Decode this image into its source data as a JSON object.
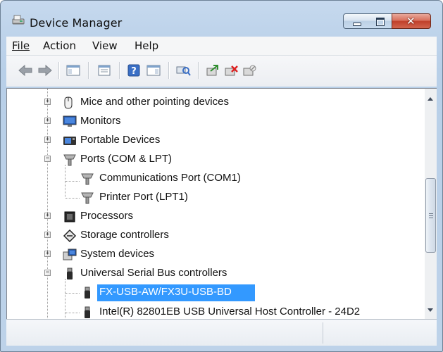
{
  "window": {
    "title": "Device Manager",
    "icon": "device-manager-icon"
  },
  "title_buttons": {
    "minimize_icon": "minimize-icon",
    "maximize_icon": "maximize-icon",
    "close_icon": "close-icon",
    "close_glyph": "✕"
  },
  "menu": [
    {
      "key": "file",
      "label": "File"
    },
    {
      "key": "action",
      "label": "Action"
    },
    {
      "key": "view",
      "label": "View"
    },
    {
      "key": "help",
      "label": "Help"
    }
  ],
  "toolbar": [
    "back-icon",
    "forward-icon",
    "show-hide-console-tree-icon",
    "properties-icon",
    "help-icon",
    "show-action-pane-icon",
    "scan-hardware-changes-icon",
    "update-driver-icon",
    "uninstall-icon",
    "disable-icon"
  ],
  "tree": {
    "items": [
      {
        "label": "Mice and other pointing devices",
        "icon": "mouse-icon",
        "state": "collapsed"
      },
      {
        "label": "Monitors",
        "icon": "monitor-icon",
        "state": "collapsed"
      },
      {
        "label": "Portable Devices",
        "icon": "portable-devices-icon",
        "state": "collapsed"
      },
      {
        "label": "Ports (COM & LPT)",
        "icon": "port-icon",
        "state": "expanded"
      },
      {
        "label": "Communications Port (COM1)",
        "icon": "port-icon",
        "state": "child"
      },
      {
        "label": "Printer Port (LPT1)",
        "icon": "port-icon",
        "state": "child"
      },
      {
        "label": "Processors",
        "icon": "processor-icon",
        "state": "collapsed"
      },
      {
        "label": "Storage controllers",
        "icon": "storage-controller-icon",
        "state": "collapsed"
      },
      {
        "label": "System devices",
        "icon": "system-devices-icon",
        "state": "collapsed"
      },
      {
        "label": "Universal Serial Bus controllers",
        "icon": "usb-icon",
        "state": "expanded"
      },
      {
        "label": "FX-USB-AW/FX3U-USB-BD",
        "icon": "usb-icon",
        "state": "child-selected"
      },
      {
        "label": "Intel(R) 82801EB USB Universal Host Controller - 24D2",
        "icon": "usb-icon",
        "state": "child"
      }
    ]
  },
  "colors": {
    "selection": "#3399ff",
    "frame": "#bfd4eb",
    "close": "#c0402a"
  }
}
